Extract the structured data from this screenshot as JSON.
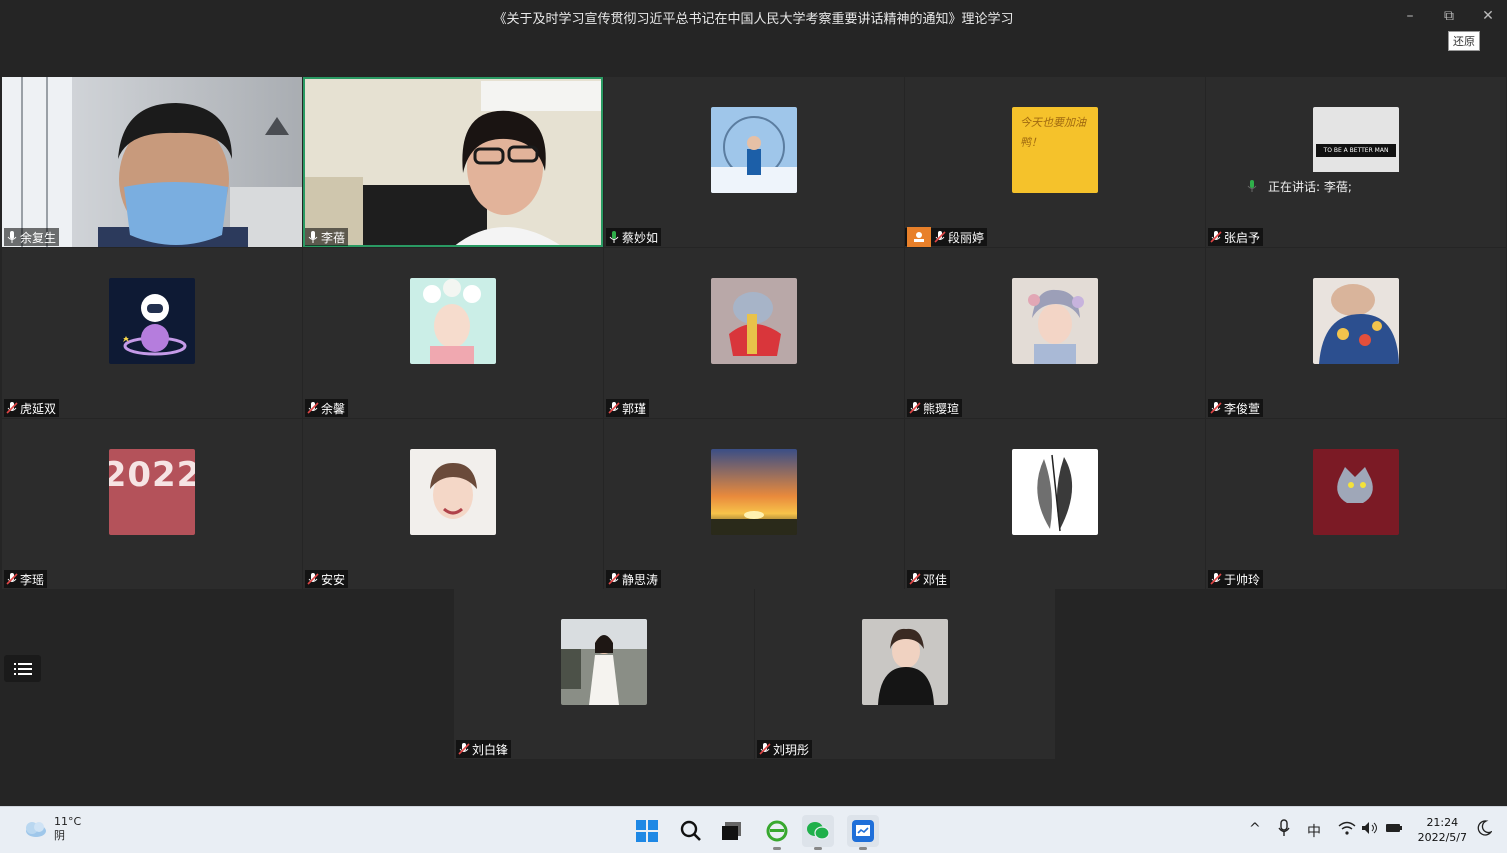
{
  "window": {
    "title": "《关于及时学习宣传贯彻习近平总书记在中国人民大学考察重要讲话精神的通知》理论学习",
    "minimize_glyph": "–",
    "restore_glyph": "⧉",
    "close_glyph": "✕",
    "restore_tooltip": "还原"
  },
  "speaking": {
    "text": "正在讲话: 李蓓;"
  },
  "participants": [
    {
      "name": "余复生",
      "kind": "video",
      "mic": "on"
    },
    {
      "name": "李蓓",
      "kind": "video",
      "mic": "on",
      "active": true
    },
    {
      "name": "蔡妙如",
      "kind": "avatar",
      "mic": "on",
      "avatar": "snow-photo"
    },
    {
      "name": "段丽婷",
      "kind": "avatar",
      "mic": "muted",
      "host": true,
      "avatar": "yellow-note",
      "avatar_text": "今天也要加油鸭！"
    },
    {
      "name": "张启予",
      "kind": "avatar",
      "mic": "muted",
      "avatar": "better-man",
      "avatar_text": "TO BE A BETTER MAN"
    },
    {
      "name": "虎延双",
      "kind": "avatar",
      "mic": "muted",
      "avatar": "astronaut"
    },
    {
      "name": "余馨",
      "kind": "avatar",
      "mic": "muted",
      "avatar": "flower-girl"
    },
    {
      "name": "郭瑾",
      "kind": "avatar",
      "mic": "muted",
      "avatar": "cartoon-cat"
    },
    {
      "name": "熊璎瑄",
      "kind": "avatar",
      "mic": "muted",
      "avatar": "painted-girl"
    },
    {
      "name": "李俊萱",
      "kind": "avatar",
      "mic": "muted",
      "avatar": "colorful-portrait"
    },
    {
      "name": "李瑶",
      "kind": "avatar",
      "mic": "muted",
      "avatar": "year-2022",
      "avatar_text": "2022"
    },
    {
      "name": "安安",
      "kind": "avatar",
      "mic": "muted",
      "avatar": "smiling-girl"
    },
    {
      "name": "静思涛",
      "kind": "avatar",
      "mic": "muted",
      "avatar": "sunset"
    },
    {
      "name": "邓佳",
      "kind": "avatar",
      "mic": "muted",
      "avatar": "feather"
    },
    {
      "name": "于帅玲",
      "kind": "avatar",
      "mic": "muted",
      "avatar": "tom-cat"
    },
    {
      "name": "刘白锋",
      "kind": "avatar",
      "mic": "muted",
      "avatar": "white-dress"
    },
    {
      "name": "刘玥彤",
      "kind": "avatar",
      "mic": "muted",
      "avatar": "black-sweater"
    }
  ],
  "taskbar": {
    "weather_temp": "11°C",
    "weather_desc": "阴",
    "ime": "中",
    "time": "21:24",
    "date": "2022/5/7",
    "caret": "^"
  },
  "colors": {
    "active_border": "#2a9a63",
    "host_badge": "#e8802a",
    "mic_on": "#2fae4a",
    "mic_muted": "#e04646"
  }
}
